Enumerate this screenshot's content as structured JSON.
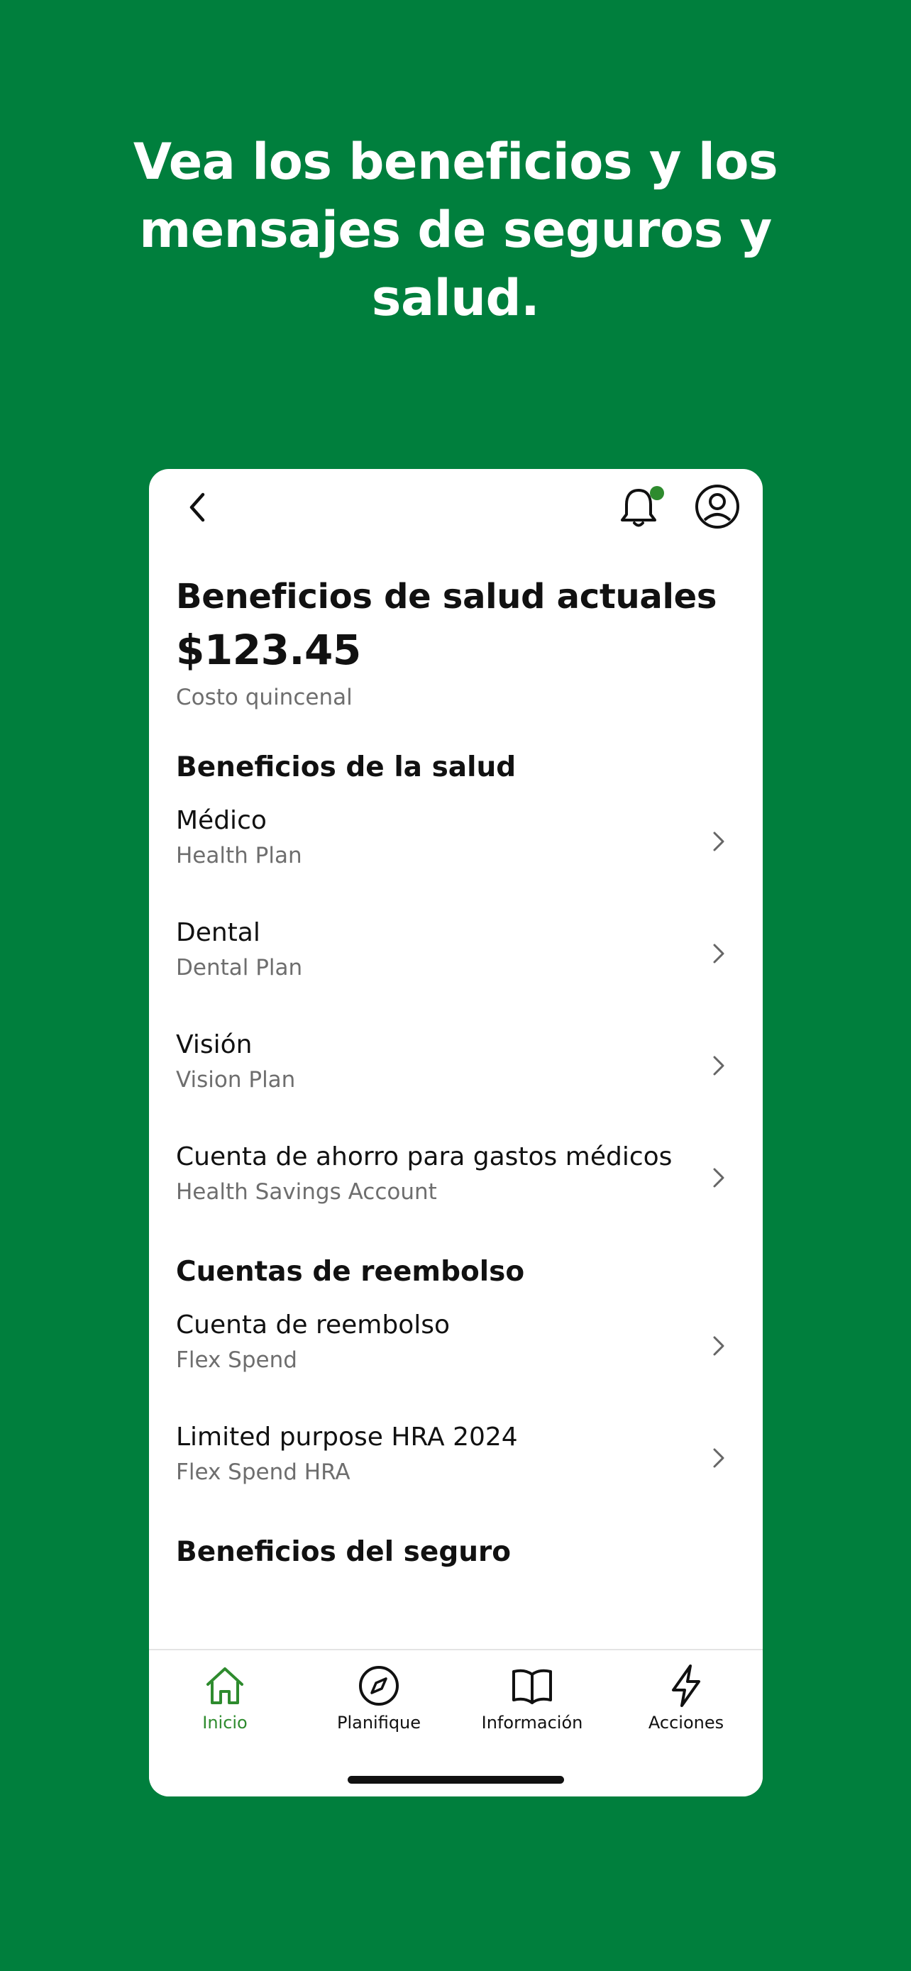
{
  "headline": {
    "line1": "Vea los beneficios y los",
    "line2": "mensajes de seguros y",
    "line3": "salud."
  },
  "colors": {
    "brand_green": "#007F3D",
    "accent_green": "#2E8B2E"
  },
  "topbar": {
    "back_icon": "chevron-left-icon",
    "bell_icon": "bell-icon",
    "profile_icon": "profile-icon"
  },
  "summary": {
    "title": "Beneficios de salud actuales",
    "amount": "$123.45",
    "amount_label": "Costo quincenal"
  },
  "sections": [
    {
      "title": "Beneficios de la salud",
      "items": [
        {
          "title": "Médico",
          "subtitle": "Health Plan"
        },
        {
          "title": "Dental",
          "subtitle": "Dental Plan"
        },
        {
          "title": "Visión",
          "subtitle": "Vision Plan"
        },
        {
          "title": "Cuenta de ahorro para gastos médicos",
          "subtitle": "Health Savings Account"
        }
      ]
    },
    {
      "title": "Cuentas de reembolso",
      "items": [
        {
          "title": "Cuenta de reembolso",
          "subtitle": "Flex Spend"
        },
        {
          "title": "Limited purpose HRA 2024",
          "subtitle": "Flex Spend HRA"
        }
      ]
    },
    {
      "title": "Beneficios del seguro",
      "items": []
    }
  ],
  "tabbar": {
    "tabs": [
      {
        "label": "Inicio",
        "icon": "home-icon",
        "active": true
      },
      {
        "label": "Planifique",
        "icon": "compass-icon",
        "active": false
      },
      {
        "label": "Información",
        "icon": "book-icon",
        "active": false
      },
      {
        "label": "Acciones",
        "icon": "lightning-icon",
        "active": false
      }
    ]
  }
}
